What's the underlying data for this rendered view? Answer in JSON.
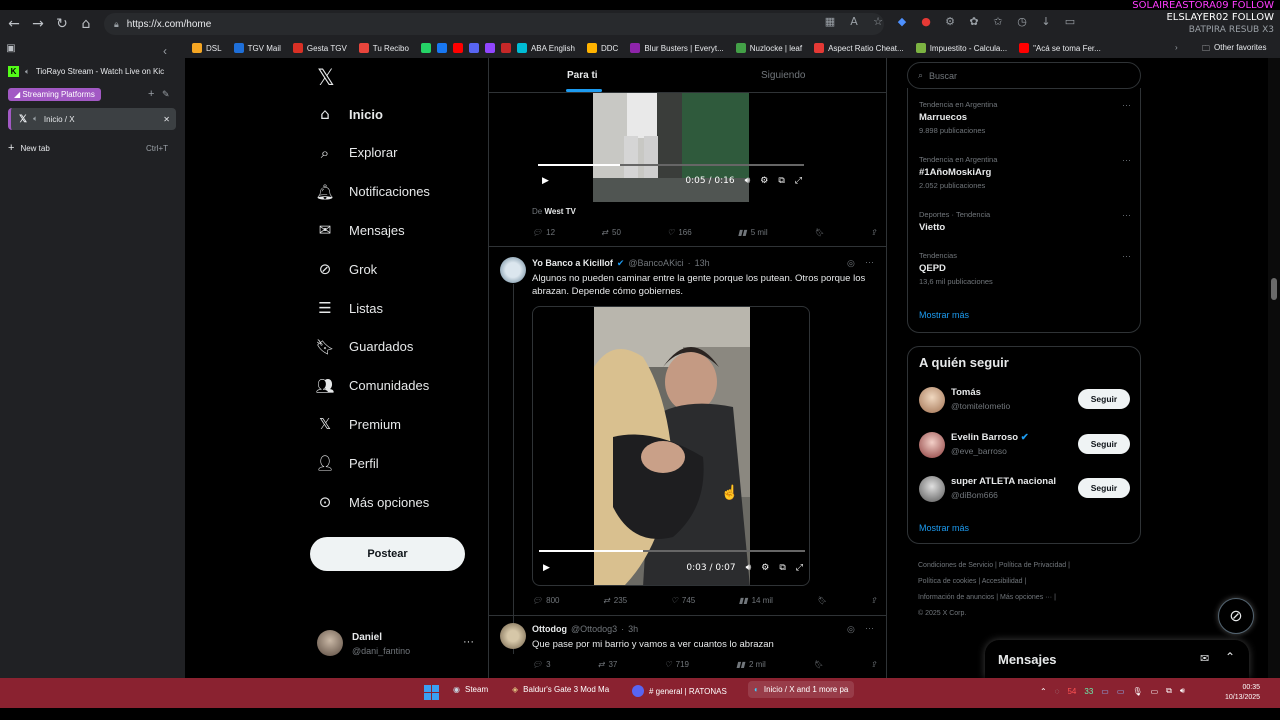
{
  "browser": {
    "url": "https://x.com/home",
    "bookmarks": [
      {
        "label": "DSL",
        "color": "#f5a623"
      },
      {
        "label": "TGV Mail",
        "color": "#1e6fd9"
      },
      {
        "label": "Gesta TGV",
        "color": "#d93025"
      },
      {
        "label": "Tu Recibo",
        "color": "#e8453c"
      },
      {
        "label": "",
        "color": "#25d366"
      },
      {
        "label": "",
        "color": "#1877f2"
      },
      {
        "label": "",
        "color": "#ff0000"
      },
      {
        "label": "",
        "color": "#5865f2"
      },
      {
        "label": "",
        "color": "#9146ff"
      },
      {
        "label": "",
        "color": "#c62828"
      },
      {
        "label": "ABA English",
        "color": "#00bcd4"
      },
      {
        "label": "DDC",
        "color": "#ffb300"
      },
      {
        "label": "Blur Busters | Everyt...",
        "color": "#8e24aa"
      },
      {
        "label": "Nuzlocke | leaf",
        "color": "#43a047"
      },
      {
        "label": "Aspect Ratio Cheat...",
        "color": "#e53935"
      },
      {
        "label": "Impuestito - Calcula...",
        "color": "#7cb342"
      },
      {
        "label": "\"Acá se toma Fer...",
        "color": "#ff0000"
      }
    ],
    "other_favorites": "Other favorites"
  },
  "stream_overlay": {
    "line1": "SOLAIREASTORA09 FOLLOW",
    "line2": "ELSLAYER02 FOLLOW",
    "line3": "BATPIRA RESUB X3"
  },
  "vertical_tabs": {
    "pinned_tab": "TioRayo Stream - Watch Live on Kic",
    "group_name": "Streaming Platforms",
    "active_tab": "Inicio / X",
    "new_tab": "New tab",
    "new_tab_shortcut": "Ctrl+T"
  },
  "nav": {
    "items": [
      {
        "icon": "home-icon",
        "label": "Inicio"
      },
      {
        "icon": "search-icon",
        "label": "Explorar"
      },
      {
        "icon": "bell-icon",
        "label": "Notificaciones"
      },
      {
        "icon": "mail-icon",
        "label": "Mensajes"
      },
      {
        "icon": "grok-icon",
        "label": "Grok"
      },
      {
        "icon": "list-icon",
        "label": "Listas"
      },
      {
        "icon": "bookmark-icon",
        "label": "Guardados"
      },
      {
        "icon": "community-icon",
        "label": "Comunidades"
      },
      {
        "icon": "x-logo-icon",
        "label": "Premium"
      },
      {
        "icon": "person-icon",
        "label": "Perfil"
      },
      {
        "icon": "more-circle-icon",
        "label": "Más opciones"
      }
    ],
    "post_button": "Postear",
    "profile": {
      "name": "Daniel",
      "handle": "@dani_fantino"
    }
  },
  "timeline": {
    "tabs": [
      "Para ti",
      "Siguiendo"
    ],
    "tweet1": {
      "video_time": "0:05 / 0:16",
      "video_progress": 0.31,
      "from_label": "De",
      "from_source": "West TV",
      "replies": "12",
      "retweets": "50",
      "likes": "166",
      "views": "5 mil"
    },
    "tweet2": {
      "name": "Yo Banco a Kicillof",
      "handle": "@BancoAKici",
      "time": "13h",
      "text": "Algunos no pueden caminar entre la gente porque los putean. Otros porque los abrazan. Depende cómo gobiernes.",
      "video_time": "0:03 / 0:07",
      "video_progress": 0.39,
      "replies": "800",
      "retweets": "235",
      "likes": "745",
      "views": "14 mil"
    },
    "tweet3": {
      "name": "Ottodog",
      "handle": "@Ottodog3",
      "time": "3h",
      "text": "Que pase por mi barrio y vamos a ver cuantos lo abrazan",
      "replies": "3",
      "retweets": "37",
      "likes": "719",
      "views": "2 mil"
    }
  },
  "right": {
    "search_placeholder": "Buscar",
    "trends": [
      {
        "category": "Tendencia en Argentina",
        "name": "Marruecos",
        "count": "9.898 publicaciones"
      },
      {
        "category": "Tendencia en Argentina",
        "name": "#1AñoMoskiArg",
        "count": "2.052 publicaciones"
      },
      {
        "category": "Deportes · Tendencia",
        "name": "Vietto",
        "count": ""
      },
      {
        "category": "Tendencias",
        "name": "QEPD",
        "count": "13,6 mil publicaciones"
      }
    ],
    "show_more": "Mostrar más",
    "who_to_follow_title": "A quién seguir",
    "who_to_follow": [
      {
        "name": "Tomás",
        "handle": "@tomitelometio",
        "verified": false,
        "button": "Seguir"
      },
      {
        "name": "Evelin Barroso",
        "handle": "@eve_barroso",
        "verified": true,
        "button": "Seguir"
      },
      {
        "name": "super ATLETA nacional",
        "handle": "@diBom666",
        "verified": false,
        "button": "Seguir"
      }
    ],
    "footer": [
      "Condiciones de Servicio",
      "Política de Privacidad",
      "Política de cookies",
      "Accesibilidad",
      "Información de anuncios",
      "Más opciones ···",
      "© 2025 X Corp."
    ],
    "messages_title": "Mensajes"
  },
  "taskbar": {
    "items": [
      "Steam",
      "Baldur's Gate 3 Mod Ma",
      "# general | RATONAS",
      "Inicio / X and 1 more pa"
    ],
    "tray_numbers": [
      "54",
      "33"
    ],
    "time": "00:35",
    "date": "10/13/2025"
  }
}
